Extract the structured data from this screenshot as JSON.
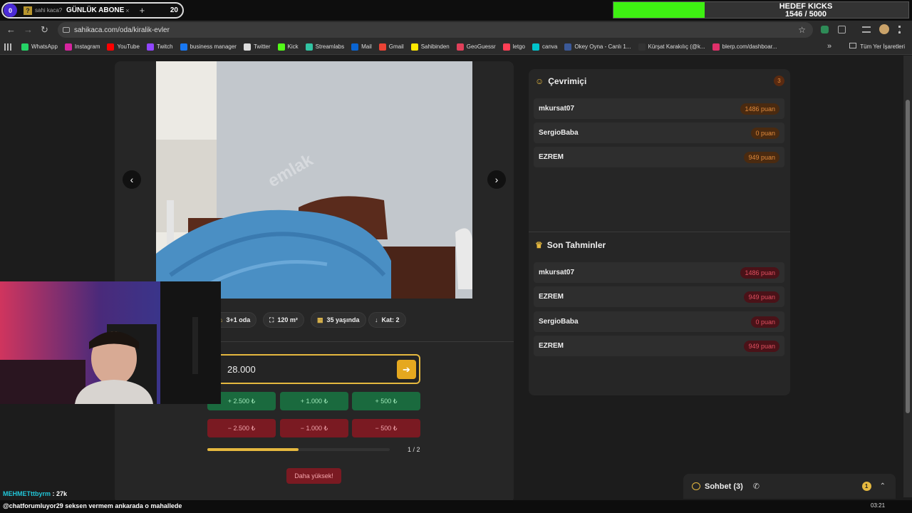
{
  "tab_overlay": {
    "sub_count": "0",
    "tab_icon": "?",
    "tab_text": "sahi kaca?",
    "title": "GÜNLÜK ABONE",
    "close": "×",
    "new_tab": "+",
    "goal": "20"
  },
  "goal_bar": {
    "title": "HEDEF KICKS",
    "progress_text": "1546 / 5000",
    "progress_fraction": 0.309,
    "color": "#3ef012"
  },
  "address_bar": {
    "url": "sahikaca.com/oda/kiralik-evler",
    "back": "←",
    "forward": "→",
    "reload": "↻",
    "star": "☆"
  },
  "bookmarks": {
    "items": [
      {
        "label": "WhatsApp",
        "color": "#25d366"
      },
      {
        "label": "Instagram",
        "color": "#d6249f"
      },
      {
        "label": "YouTube",
        "color": "#ff0000"
      },
      {
        "label": "Twitch",
        "color": "#9146ff"
      },
      {
        "label": "business manager",
        "color": "#1877f2"
      },
      {
        "label": "Twitter",
        "color": "#dddddd"
      },
      {
        "label": "Kick",
        "color": "#53fc18"
      },
      {
        "label": "Streamlabs",
        "color": "#31c3a2"
      },
      {
        "label": "Mail",
        "color": "#0a64d2"
      },
      {
        "label": "Gmail",
        "color": "#ea4335"
      },
      {
        "label": "Sahibinden",
        "color": "#ffe800"
      },
      {
        "label": "GeoGuessr",
        "color": "#e0405a"
      },
      {
        "label": "letgo",
        "color": "#ff3f55"
      },
      {
        "label": "canva",
        "color": "#00c4cc"
      },
      {
        "label": "Okey Oyna - Canlı 1...",
        "color": "#3b5998"
      },
      {
        "label": "Kürşat Karakılıç (@k...",
        "color": "#333333"
      },
      {
        "label": "blerp.com/dashboar...",
        "color": "#e0306a"
      }
    ],
    "more": "»",
    "all_bookmarks": "Tüm Yer İşaretleri"
  },
  "listing": {
    "prev": "‹",
    "next": "›",
    "watermark": "emlak",
    "tags": [
      {
        "icon": "⌂",
        "label": "3+1 oda"
      },
      {
        "icon": "⛶",
        "label": "120 m²"
      },
      {
        "icon": "▦",
        "label": "35 yaşında"
      },
      {
        "icon": "↓",
        "label": "Kat: 2"
      }
    ]
  },
  "guess": {
    "value": "28.000",
    "submit_icon": "➔",
    "plus_buttons": [
      "+ 2.500 ₺",
      "+ 1.000 ₺",
      "+ 500 ₺"
    ],
    "minus_buttons": [
      "− 2.500 ₺",
      "− 1.000 ₺",
      "− 500 ₺"
    ],
    "progress_text": "1 / 2",
    "progress_fraction": 0.5,
    "hint": "Daha yüksek!"
  },
  "online": {
    "title": "Çevrimiçi",
    "count": "3",
    "players": [
      {
        "name": "mkursat07",
        "points": "1486 puan"
      },
      {
        "name": "SergioBaba",
        "points": "0 puan"
      },
      {
        "name": "EZREM",
        "points": "949 puan"
      }
    ]
  },
  "recent": {
    "title": "Son Tahminler",
    "entries": [
      {
        "name": "mkursat07",
        "points": "1486 puan"
      },
      {
        "name": "EZREM",
        "points": "949 puan"
      },
      {
        "name": "SergioBaba",
        "points": "0 puan"
      },
      {
        "name": "EZREM",
        "points": "949 puan"
      }
    ]
  },
  "chat": {
    "label": "Sohbet (3)",
    "badge": "1",
    "chevron": "⌃"
  },
  "stream_overlay": {
    "viewer_name": "MEHMETttbyrm",
    "viewer_value": " : 27k",
    "ticker": "@chatforumluyor29 seksen vermem ankarada o mahallede",
    "clock": "03:21"
  }
}
